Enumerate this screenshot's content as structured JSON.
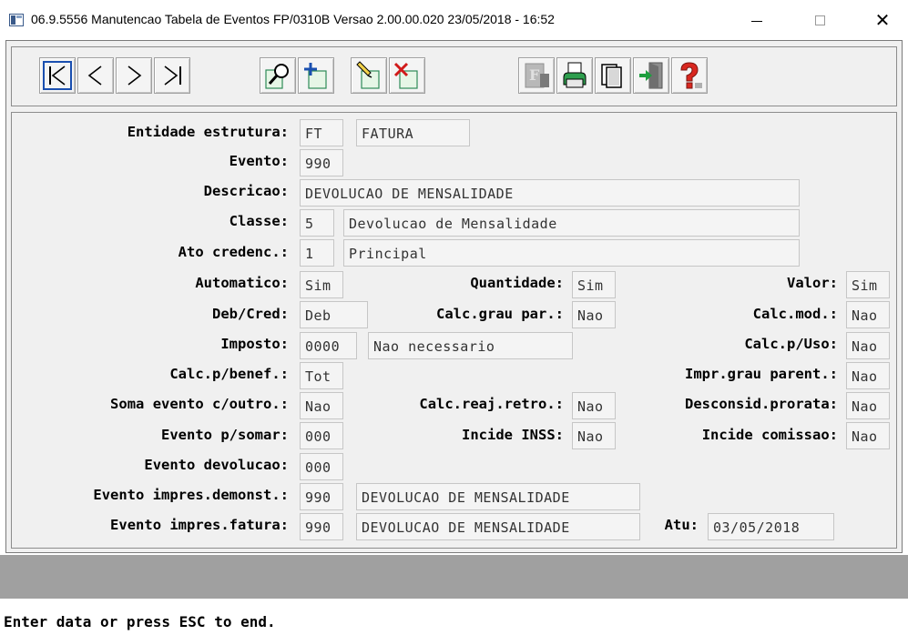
{
  "window": {
    "title": "06.9.5556 Manutencao  Tabela de Eventos FP/0310B Versao 2.00.00.020 23/05/2018 - 16:52",
    "minimize_icon": "minimize-icon",
    "maximize_icon": "maximize-icon",
    "close_glyph": "✕"
  },
  "toolbar": {
    "buttons": [
      {
        "name": "first-record-button",
        "icon": "first-icon"
      },
      {
        "name": "previous-record-button",
        "icon": "previous-icon"
      },
      {
        "name": "next-record-button",
        "icon": "next-icon"
      },
      {
        "name": "last-record-button",
        "icon": "last-icon"
      },
      {
        "name": "search-button",
        "icon": "magnifier-icon"
      },
      {
        "name": "add-button",
        "icon": "add-icon"
      },
      {
        "name": "edit-button",
        "icon": "edit-icon"
      },
      {
        "name": "delete-button",
        "icon": "delete-icon"
      },
      {
        "name": "filter-button",
        "icon": "filter-icon"
      },
      {
        "name": "print-button",
        "icon": "printer-icon"
      },
      {
        "name": "copy-button",
        "icon": "copy-icon"
      },
      {
        "name": "exit-button",
        "icon": "exit-door-icon"
      },
      {
        "name": "help-button",
        "icon": "help-icon"
      }
    ]
  },
  "form": {
    "entidade": {
      "label": "Entidade estrutura:",
      "code": "FT",
      "desc": "FATURA"
    },
    "evento": {
      "label": "Evento:",
      "value": "990"
    },
    "descricao": {
      "label": "Descricao:",
      "value": "DEVOLUCAO DE MENSALIDADE"
    },
    "classe": {
      "label": "Classe:",
      "code": "5",
      "desc": "Devolucao de Mensalidade"
    },
    "ato": {
      "label": "Ato credenc.:",
      "code": "1",
      "desc": "Principal"
    },
    "automatico": {
      "label": "Automatico:",
      "value": "Sim"
    },
    "quantidade": {
      "label": "Quantidade:",
      "value": "Sim"
    },
    "valor": {
      "label": "Valor:",
      "value": "Sim"
    },
    "debcred": {
      "label": "Deb/Cred:",
      "value": "Deb"
    },
    "calcgrau": {
      "label": "Calc.grau par.:",
      "value": "Nao"
    },
    "calcmod": {
      "label": "Calc.mod.:",
      "value": "Nao"
    },
    "imposto": {
      "label": "Imposto:",
      "code": "0000",
      "desc": "Nao necessario"
    },
    "calcuso": {
      "label": "Calc.p/Uso:",
      "value": "Nao"
    },
    "calcbenef": {
      "label": "Calc.p/benef.:",
      "value": "Tot"
    },
    "imprgrau": {
      "label": "Impr.grau parent.:",
      "value": "Nao"
    },
    "soma": {
      "label": "Soma evento c/outro.:",
      "value": "Nao"
    },
    "calcreaj": {
      "label": "Calc.reaj.retro.:",
      "value": "Nao"
    },
    "desconsid": {
      "label": "Desconsid.prorata:",
      "value": "Nao"
    },
    "eventosomar": {
      "label": "Evento p/somar:",
      "value": "000"
    },
    "incideinss": {
      "label": "Incide INSS:",
      "value": "Nao"
    },
    "incidecom": {
      "label": "Incide comissao:",
      "value": "Nao"
    },
    "eventodev": {
      "label": "Evento devolucao:",
      "value": "000"
    },
    "impdemonst": {
      "label": "Evento impres.demonst.:",
      "code": "990",
      "desc": "DEVOLUCAO DE MENSALIDADE"
    },
    "impfatura": {
      "label": "Evento impres.fatura:",
      "code": "990",
      "desc": "DEVOLUCAO DE MENSALIDADE"
    },
    "atu": {
      "label": "Atu:",
      "value": "03/05/2018"
    }
  },
  "status": {
    "text": "Enter data or press ESC to end."
  }
}
